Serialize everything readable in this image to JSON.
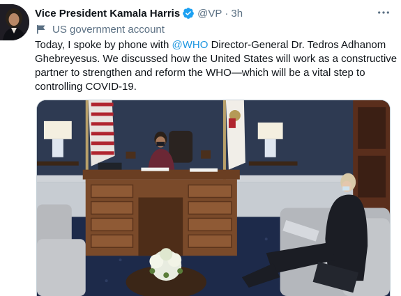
{
  "tweet": {
    "author_name": "Vice President Kamala Harris",
    "handle": "@VP",
    "separator": "·",
    "time": "3h",
    "account_label": "US government account",
    "text_before": "Today, I spoke by phone with ",
    "mention": "@WHO",
    "text_after": " Director-General Dr. Tedros Adhanom Ghebreyesus. We discussed how the United States will work as a constructive partner to strengthen and reform the WHO—which will be a vital step to controlling COVID-19.",
    "icons": {
      "verified": "verified-badge-icon",
      "more": "more-options-icon",
      "account": "flag-icon"
    },
    "colors": {
      "link": "#1b95e0",
      "secondary": "#5b7083",
      "verified": "#1da1f2"
    }
  }
}
